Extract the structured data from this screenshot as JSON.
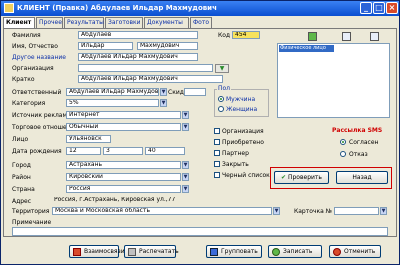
{
  "window": {
    "title": "КЛИЕНТ (Правка) Абдулаев Ильдар Махмудович",
    "min": "_",
    "max": "□",
    "close": "×"
  },
  "tabs": [
    "Клиент",
    "Прочее",
    "Результаты",
    "Заготовки",
    "Документы",
    "Фото"
  ],
  "form": {
    "surname_label": "Фамилия",
    "surname": "Абдулаев",
    "name_label": "Имя, Отчество",
    "name": "Ильдар",
    "patronymic": "Махмудович",
    "other_name_label": "Другое название",
    "other_name": "Абдулаев Ильдар Махмудович",
    "specialties_label": "Организация",
    "short_label": "Кратко",
    "short": "Абдулаев Ильдар Махмудович",
    "responsible_label": "Ответственный",
    "responsible": "Абдулаев Ильдар Махмудович",
    "discount_label": "Скидка",
    "category_label": "Категория",
    "category": "5%",
    "ad_source_label": "Источник рекламы",
    "ad_source": "Интернет",
    "trade_label": "Торговое отношение",
    "trade": "Обычный",
    "person_label": "Лицо",
    "person": "Ульяновск",
    "birth_label": "Дата рождения",
    "birth_d": "12",
    "birth_m": "3",
    "birth_y": "40",
    "city_label": "Город",
    "city": "Астрахань",
    "district_label": "Район",
    "district": "Кировский",
    "country_label": "Страна",
    "country": "Россия",
    "address_label": "Адрес",
    "address": "Россия, г.Астрахань, Кировская ул.,77",
    "territory_label": "Территория",
    "territory": "Москва и Московская область",
    "card_label": "Карточка №",
    "notes_label": "Примечание",
    "code_label": "Код",
    "code": "454"
  },
  "sex": {
    "title": "Пол",
    "options": [
      "Мужчина",
      "Женщина"
    ],
    "selected": 0
  },
  "flags": [
    "Организация",
    "Приобретено",
    "Партнер",
    "Закрыть",
    "Черный список"
  ],
  "mailing": {
    "title": "Рассылка SMS",
    "options": [
      "Согласен",
      "Отказ"
    ],
    "selected": 0
  },
  "list": {
    "selected_item": "Физическое лицо"
  },
  "buttons": {
    "approve": "Проверить",
    "skip": "Назад"
  },
  "bottom": [
    "Взаимосвязи",
    "Распечатать",
    "Групповать",
    "Записать",
    "Отменить"
  ],
  "colors": {
    "title_bar": "#0a4ed0",
    "selection": "#316ac5",
    "code_bg": "#f7e25c",
    "red_frame": "#d00000"
  }
}
